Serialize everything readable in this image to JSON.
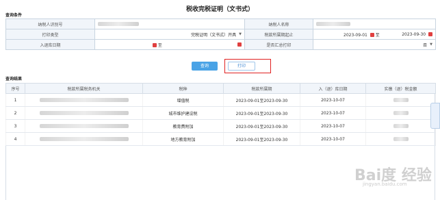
{
  "page": {
    "title": "税收完税证明（文书式）"
  },
  "conditions": {
    "section_label": "查询条件",
    "taxpayer_id_label": "纳税人识别号",
    "taxpayer_name_label": "纳税人名称",
    "print_type_label": "打印类型",
    "print_type_value": "完税证明（文书式）开具",
    "tax_period_start_label": "税款所属期起止",
    "tax_period_from": "2023-09-01",
    "tax_period_sep": "至",
    "tax_period_to": "2023-09-30",
    "entry_date_label": "入退库日期",
    "entry_date_sep": "至",
    "summary_print_label": "是否汇总打印",
    "summary_print_value": "否"
  },
  "actions": {
    "query_label": "查询",
    "print_label": "打印"
  },
  "results": {
    "section_label": "查询结果",
    "columns": [
      "序号",
      "税款所属税务机关",
      "税种",
      "税款所属期",
      "入（退）库日期",
      "实缴（退）税金额"
    ],
    "rows": [
      {
        "no": "1",
        "tax_type": "增值税",
        "period": "2023-09-01至2023-09-30",
        "date": "2023-10-07"
      },
      {
        "no": "2",
        "tax_type": "城市维护建设税",
        "period": "2023-09-01至2023-09-30",
        "date": "2023-10-07"
      },
      {
        "no": "3",
        "tax_type": "教育费附加",
        "period": "2023-09-01至2023-09-30",
        "date": "2023-10-07"
      },
      {
        "no": "4",
        "tax_type": "地方教育附加",
        "period": "2023-09-01至2023-09-30",
        "date": "2023-10-07"
      }
    ]
  },
  "watermark": {
    "main": "Bai度 经验",
    "sub": "jingyan.baidu.com"
  },
  "colors": {
    "query_button": "#4aa3e6",
    "highlight": "#e02020",
    "header_bg": "#f1f5fa"
  }
}
